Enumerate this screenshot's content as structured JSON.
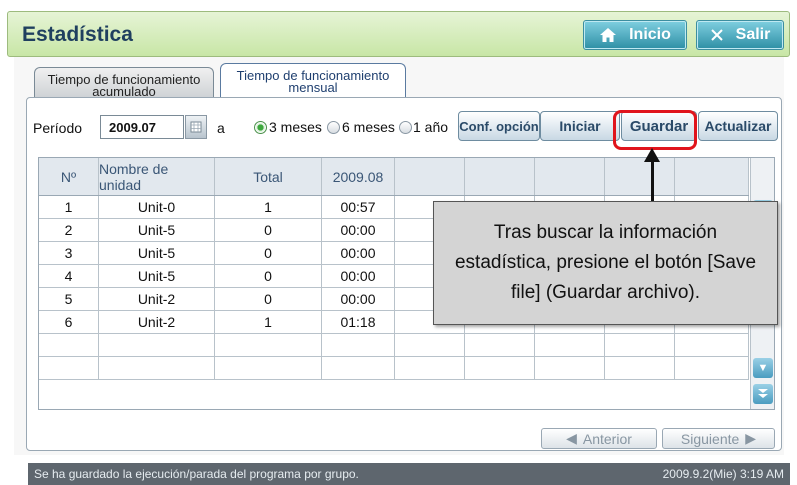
{
  "header": {
    "title": "Estadística",
    "inicio_label": "Inicio",
    "salir_label": "Salir"
  },
  "tabs": [
    {
      "line1": "Tiempo de funcionamiento",
      "line2": "acumulado"
    },
    {
      "line1": "Tiempo de funcionamiento",
      "line2": "mensual"
    }
  ],
  "toolbar": {
    "period_label": "Período",
    "period_value": "2009.07",
    "to_label": "a",
    "radio_options": [
      "3 meses",
      "6 meses",
      "1 año"
    ],
    "selected_radio": "3 meses",
    "conf_label": "Conf. opción",
    "iniciar_label": "Iniciar",
    "guardar_label": "Guardar",
    "actualizar_label": "Actualizar"
  },
  "table": {
    "headers": [
      "Nº",
      "Nombre de unidad",
      "Total",
      "2009.08",
      "",
      "",
      "",
      "",
      ""
    ],
    "rows": [
      [
        "1",
        "Unit-0",
        "1",
        "00:57"
      ],
      [
        "2",
        "Unit-5",
        "0",
        "00:00"
      ],
      [
        "3",
        "Unit-5",
        "0",
        "00:00"
      ],
      [
        "4",
        "Unit-5",
        "0",
        "00:00"
      ],
      [
        "5",
        "Unit-2",
        "0",
        "00:00"
      ],
      [
        "6",
        "Unit-2",
        "1",
        "01:18"
      ],
      [
        "",
        "",
        "",
        ""
      ],
      [
        "",
        "",
        "",
        ""
      ]
    ]
  },
  "callout": {
    "line1": "Tras buscar la información",
    "line2": "estadística, presione el botón [Save",
    "line3": "file] (Guardar archivo)."
  },
  "pagination": {
    "prev_label": "Anterior",
    "next_label": "Siguiente"
  },
  "status": {
    "message": "Se ha guardado la ejecución/parada del programa por grupo.",
    "datetime": "2009.9.2(Mie)  3:19 AM"
  },
  "colors": {
    "accent": "#2e8fa5",
    "highlight": "#e0141c",
    "header_bg": "#c8e6a6"
  },
  "icons": [
    "home-icon",
    "close-icon",
    "calendar-icon",
    "arrow-down-icon",
    "arrow-double-down-icon",
    "arrow-left-icon",
    "arrow-right-icon"
  ]
}
